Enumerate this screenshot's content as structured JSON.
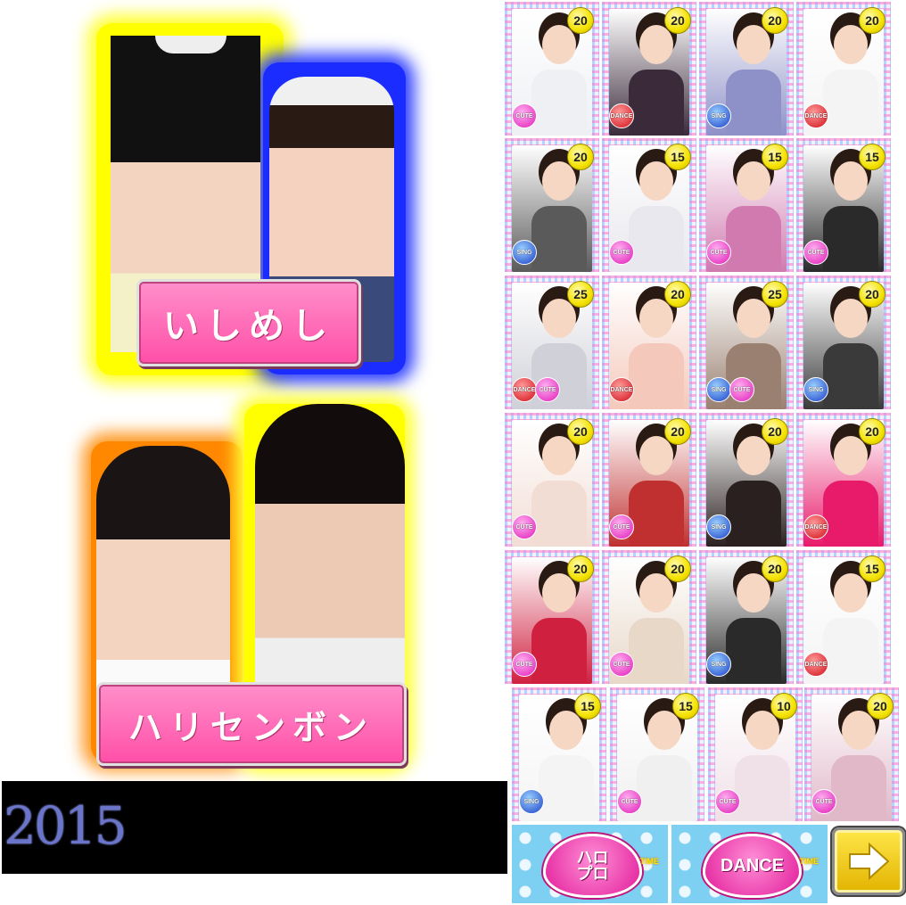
{
  "pairs": [
    {
      "name": "いしめし",
      "glow_colors": [
        "#ffff00",
        "#1a2cff"
      ]
    },
    {
      "name": "ハリセンボン",
      "glow_colors": [
        "#ff8800",
        "#ffff00"
      ]
    }
  ],
  "year": "2015",
  "cards": [
    {
      "cost": "20",
      "badges": [
        "CUTE"
      ],
      "tone": "#eef0f4"
    },
    {
      "cost": "20",
      "badges": [
        "DANCE"
      ],
      "tone": "#3a2a3a"
    },
    {
      "cost": "20",
      "badges": [
        "SING"
      ],
      "tone": "#8e90c8"
    },
    {
      "cost": "20",
      "badges": [
        "DANCE"
      ],
      "tone": "#f4f4f4"
    },
    {
      "cost": "20",
      "badges": [
        "SING"
      ],
      "tone": "#5a5a5a"
    },
    {
      "cost": "15",
      "badges": [
        "CUTE"
      ],
      "tone": "#e8e8ee"
    },
    {
      "cost": "15",
      "badges": [
        "CUTE"
      ],
      "tone": "#d07ab0"
    },
    {
      "cost": "15",
      "badges": [
        "CUTE"
      ],
      "tone": "#2a2a2a"
    },
    {
      "cost": "25",
      "badges": [
        "DANCE",
        "CUTE"
      ],
      "tone": "#cfd0d8"
    },
    {
      "cost": "20",
      "badges": [
        "DANCE"
      ],
      "tone": "#f4c9bc"
    },
    {
      "cost": "25",
      "badges": [
        "SING",
        "CUTE"
      ],
      "tone": "#9a8070"
    },
    {
      "cost": "20",
      "badges": [
        "SING"
      ],
      "tone": "#3a3a3a"
    },
    {
      "cost": "20",
      "badges": [
        "CUTE"
      ],
      "tone": "#f2ddd5"
    },
    {
      "cost": "20",
      "badges": [
        "CUTE"
      ],
      "tone": "#c03030"
    },
    {
      "cost": "20",
      "badges": [
        "SING"
      ],
      "tone": "#2a2020"
    },
    {
      "cost": "20",
      "badges": [
        "DANCE"
      ],
      "tone": "#e81a6a"
    },
    {
      "cost": "20",
      "badges": [
        "CUTE"
      ],
      "tone": "#d02040"
    },
    {
      "cost": "20",
      "badges": [
        "CUTE"
      ],
      "tone": "#e8d8c8"
    },
    {
      "cost": "20",
      "badges": [
        "SING"
      ],
      "tone": "#2a2a2a"
    },
    {
      "cost": "15",
      "badges": [
        "DANCE"
      ],
      "tone": "#f4f4f4"
    },
    {
      "cost": "15",
      "badges": [
        "SING"
      ],
      "tone": "#f4f4f4"
    },
    {
      "cost": "15",
      "badges": [
        "CUTE"
      ],
      "tone": "#f0f0f0"
    },
    {
      "cost": "10",
      "badges": [
        "CUTE"
      ],
      "tone": "#f0e0e8"
    },
    {
      "cost": "20",
      "badges": [
        "CUTE"
      ],
      "tone": "#e0b8c8"
    }
  ],
  "buttons": {
    "hello_pro_label": "ハロ\nプロ",
    "dance_label": "DANCE",
    "time_label": "TIME",
    "next_icon": "arrow-right-icon"
  },
  "colors": {
    "cute": "#e01cb8",
    "dance": "#d0101a",
    "sing": "#1a40c8",
    "accent_pink": "#ff4fa7"
  }
}
